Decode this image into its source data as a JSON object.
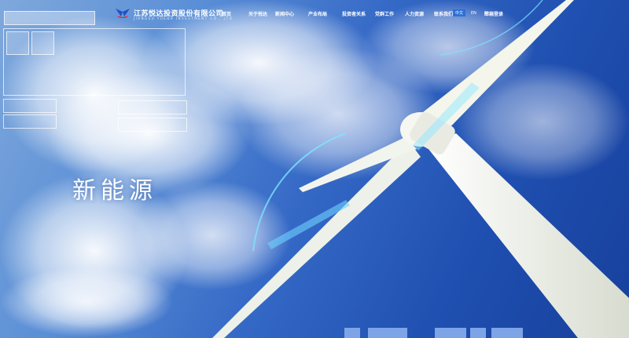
{
  "header": {
    "logo_cn": "江苏悦达投资股份有限公司",
    "logo_en": "JIANGSU YUEDA INVESTMENT CO., LTD",
    "nav": [
      "首页",
      "关于悦达",
      "新闻中心",
      "产业布局",
      "投资者关系",
      "党群工作",
      "人力资源",
      "联系我们"
    ],
    "lang": {
      "zh": "中文",
      "en": "EN"
    },
    "mail": "邮箱登录"
  },
  "hero": {
    "title": "新能源"
  },
  "colors": {
    "accent": "#2d6fd8",
    "sky": "#1f4fb0"
  }
}
